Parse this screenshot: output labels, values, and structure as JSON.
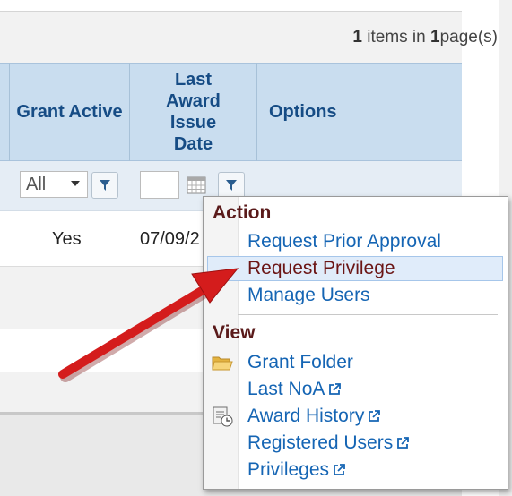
{
  "pager": {
    "count": "1",
    "items_text": "items in",
    "pages": "1",
    "pages_suffix": "page(s)"
  },
  "table": {
    "columns": [
      {
        "label": "Grant Active"
      },
      {
        "label": "Last Award Issue Date"
      },
      {
        "label": "Options"
      }
    ],
    "filters": {
      "grant_active_value": "All"
    },
    "row": {
      "grant_active": "Yes",
      "last_award_date": "07/09/2"
    }
  },
  "menu": {
    "action_title": "Action",
    "action_items": [
      "Request Prior Approval",
      "Request Privilege",
      "Manage Users"
    ],
    "highlighted_item": "Request Privilege",
    "view_title": "View",
    "view_items": [
      "Grant Folder",
      "Last NoA",
      "Award History",
      "Registered Users",
      "Privileges"
    ]
  },
  "colors": {
    "header_bg": "#c9ddef",
    "header_text": "#164c85",
    "link": "#1565b4",
    "section_title": "#5a1a1a",
    "highlight_bg": "#e0ecfa",
    "arrow": "#d41c1c"
  },
  "icons": [
    "filter-icon",
    "calendar-icon",
    "folder-icon",
    "history-icon",
    "external-link-icon",
    "dropdown-arrow-icon"
  ]
}
